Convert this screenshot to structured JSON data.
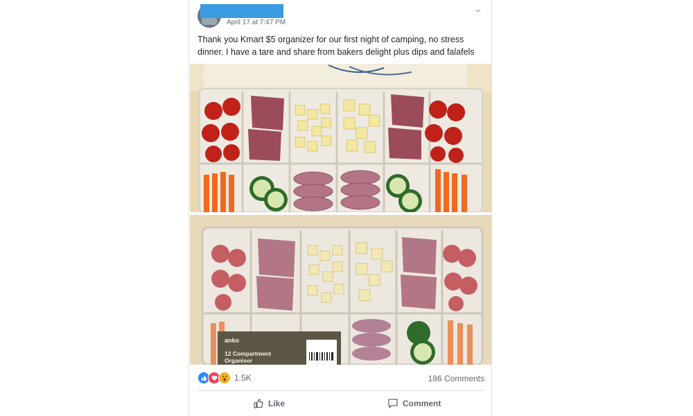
{
  "post": {
    "timestamp": "April 17 at 7:47 PM",
    "text": "Thank you Kmart $5 organizer for our first night of camping, no stress dinner. I have a tare and share from bakers delight plus dips and falafels",
    "chevron_icon": "chevron-down-icon"
  },
  "photos": [
    {
      "description_icon": "food-organizer-photo-open"
    },
    {
      "description_icon": "food-organizer-photo-closed",
      "label_brand": "anko",
      "label_line1": "12 Compartment",
      "label_line2": "Organiser"
    }
  ],
  "reactions": {
    "icons": [
      "like-reaction-icon",
      "love-reaction-icon",
      "wow-reaction-icon"
    ],
    "count": "1.5K"
  },
  "comments": {
    "count_label": "186 Comments"
  },
  "actions": {
    "like_label": "Like",
    "comment_label": "Comment"
  },
  "colors": {
    "accent": "#2d88ff",
    "love": "#f33e58",
    "wow": "#f7b125",
    "redaction": "#3a9be0",
    "secondary_text": "#616770"
  }
}
